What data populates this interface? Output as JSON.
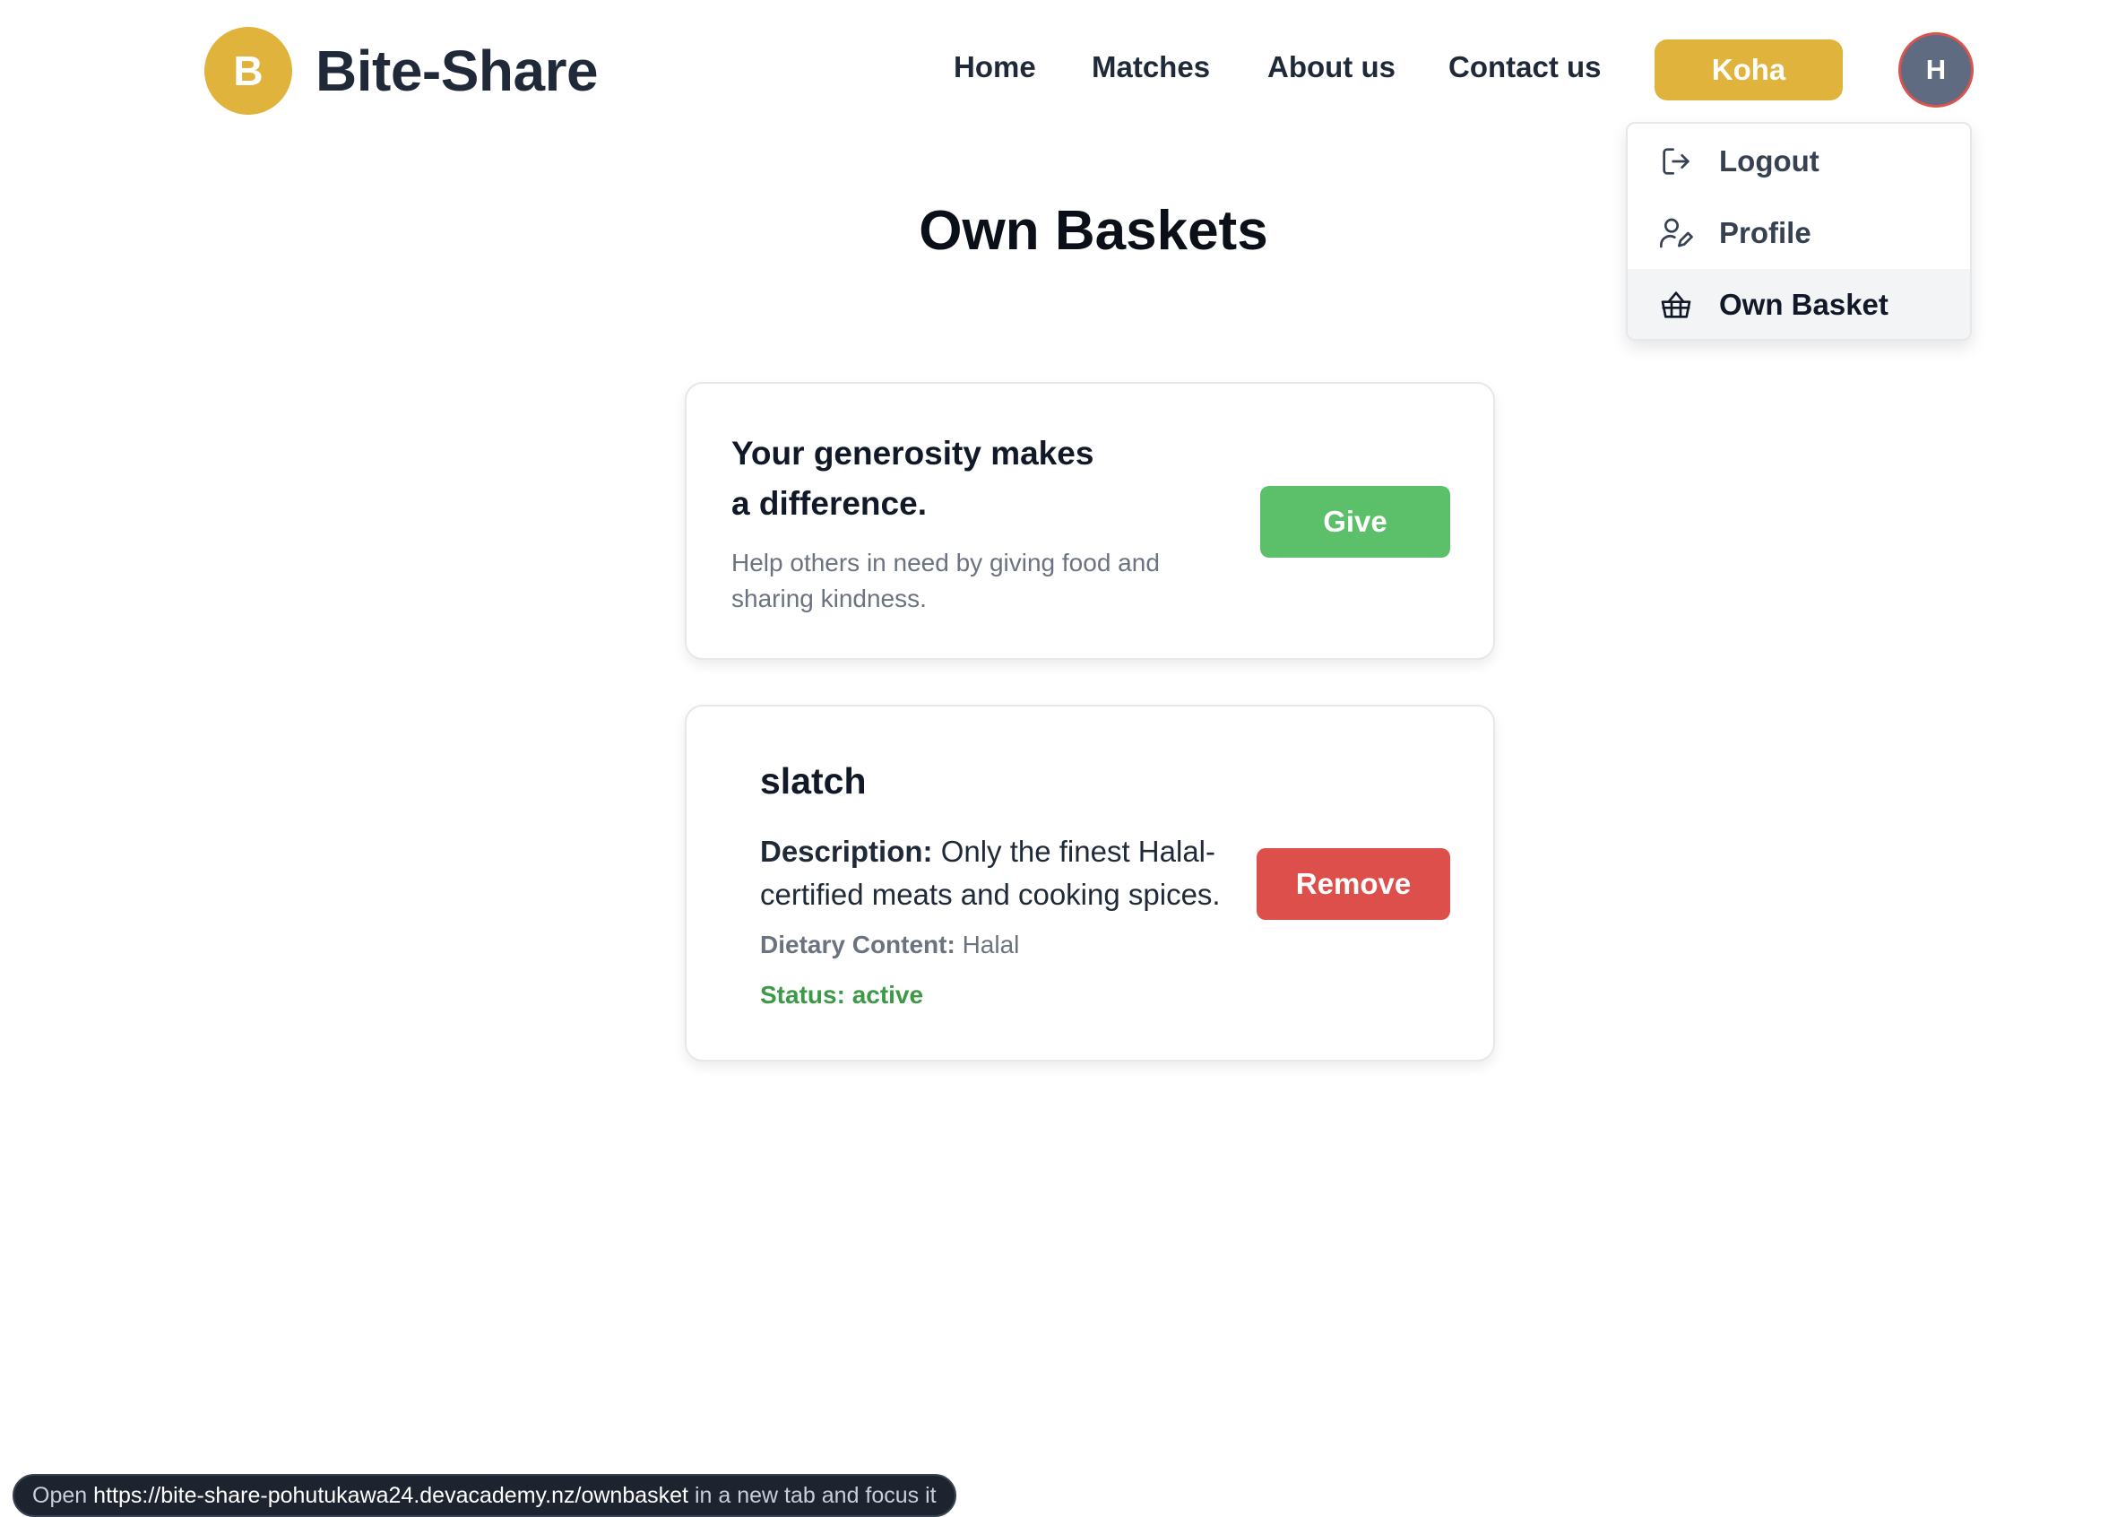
{
  "header": {
    "logo_letter": "B",
    "brand": "Bite-Share",
    "nav": {
      "home": "Home",
      "matches": "Matches",
      "about": "About us",
      "contact": "Contact us"
    },
    "koha_label": "Koha",
    "avatar_initial": "H"
  },
  "dropdown": {
    "items": [
      {
        "label": "Logout",
        "icon": "logout-icon"
      },
      {
        "label": "Profile",
        "icon": "profile-icon"
      },
      {
        "label": "Own Basket",
        "icon": "basket-icon",
        "active": true
      }
    ]
  },
  "page": {
    "title": "Own Baskets"
  },
  "give_card": {
    "heading": "Your generosity makes a difference.",
    "subtext": "Help others in need by giving food and sharing kindness.",
    "button": "Give"
  },
  "basket": {
    "name": "slatch",
    "description_label": "Description:",
    "description": "Only the finest Halal-certified meats and cooking spices.",
    "dietary_label": "Dietary Content:",
    "dietary": "Halal",
    "status_label": "Status:",
    "status": "active",
    "remove_button": "Remove"
  },
  "statusbar": {
    "prefix": "Open",
    "url": "https://bite-share-pohutukawa24.devacademy.nz/ownbasket",
    "suffix": "in a new tab and focus it"
  },
  "colors": {
    "brand_yellow": "#e0b33c",
    "give_green": "#5cbf6a",
    "remove_red": "#dd4f4a",
    "status_green": "#3c9a46",
    "avatar_bg": "#5f6b80"
  }
}
